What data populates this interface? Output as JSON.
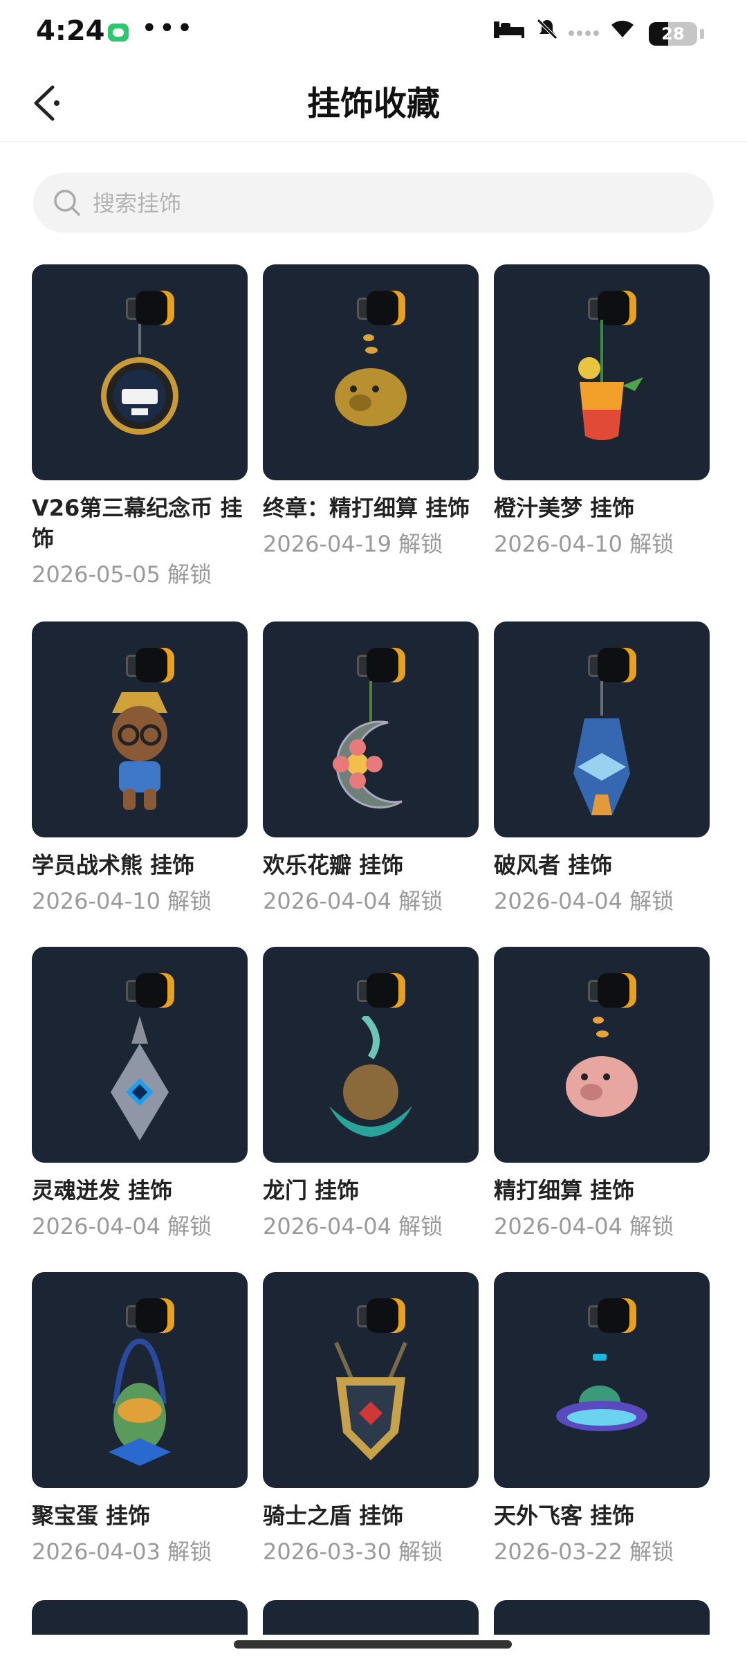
{
  "status_bar": {
    "time": "4:24",
    "battery": "28",
    "dots": "•••"
  },
  "header": {
    "title": "挂饰收藏",
    "back_icon": "chevron-left-icon"
  },
  "search": {
    "placeholder": "搜索挂饰",
    "value": ""
  },
  "items": [
    {
      "name": "V26第三幕纪念币 挂饰",
      "date": "2026-05-05 解锁",
      "charm": "medal"
    },
    {
      "name": "终章：精打细算 挂饰",
      "date": "2026-04-19 解锁",
      "charm": "golden-pig"
    },
    {
      "name": "橙汁美梦 挂饰",
      "date": "2026-04-10 解锁",
      "charm": "juice"
    },
    {
      "name": "学员战术熊 挂饰",
      "date": "2026-04-10 解锁",
      "charm": "bear"
    },
    {
      "name": "欢乐花瓣 挂饰",
      "date": "2026-04-04 解锁",
      "charm": "flower-moon"
    },
    {
      "name": "破风者 挂饰",
      "date": "2026-04-04 解锁",
      "charm": "blue-blade"
    },
    {
      "name": "灵魂迸发 挂饰",
      "date": "2026-04-04 解锁",
      "charm": "crystal"
    },
    {
      "name": "龙门 挂饰",
      "date": "2026-04-04 解锁",
      "charm": "dragon"
    },
    {
      "name": "精打细算 挂饰",
      "date": "2026-04-04 解锁",
      "charm": "pink-pig"
    },
    {
      "name": "聚宝蛋 挂饰",
      "date": "2026-04-03 解锁",
      "charm": "egg"
    },
    {
      "name": "骑士之盾 挂饰",
      "date": "2026-03-30 解锁",
      "charm": "shield"
    },
    {
      "name": "天外飞客 挂饰",
      "date": "2026-03-22 解锁",
      "charm": "ufo"
    }
  ],
  "colors": {
    "card_bg": "#1c2533",
    "accent": "#e7a020",
    "date_text": "#9a9a9a"
  }
}
